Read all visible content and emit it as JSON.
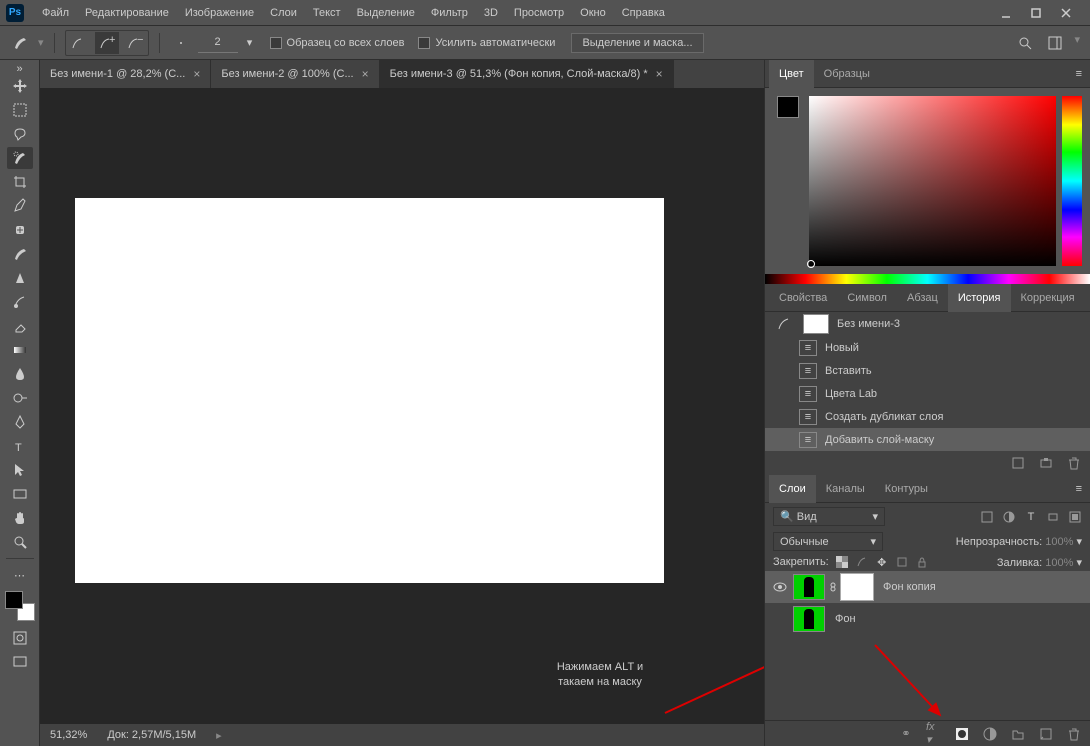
{
  "menubar": {
    "items": [
      "Файл",
      "Редактирование",
      "Изображение",
      "Слои",
      "Текст",
      "Выделение",
      "Фильтр",
      "3D",
      "Просмотр",
      "Окно",
      "Справка"
    ]
  },
  "options_bar": {
    "brush_size": "2",
    "sample_all": "Образец со всех слоев",
    "auto_enhance": "Усилить автоматически",
    "select_mask": "Выделение и маска..."
  },
  "doc_tabs": [
    {
      "label": "Без имени-1 @ 28,2% (С...",
      "active": false
    },
    {
      "label": "Без имени-2 @ 100% (С...",
      "active": false
    },
    {
      "label": "Без имени-3 @ 51,3% (Фон копия, Слой-маска/8) *",
      "active": true
    }
  ],
  "status": {
    "zoom": "51,32%",
    "doc": "Док: 2,57M/5,15M"
  },
  "color_panel": {
    "tabs": [
      "Цвет",
      "Образцы"
    ]
  },
  "props_panel": {
    "tabs": [
      "Свойства",
      "Символ",
      "Абзац",
      "История",
      "Коррекция"
    ],
    "active": 3
  },
  "history": {
    "doc_name": "Без имени-3",
    "items": [
      "Новый",
      "Вставить",
      "Цвета Lab",
      "Создать дубликат слоя",
      "Добавить слой-маску"
    ]
  },
  "layers_panel": {
    "tabs": [
      "Слои",
      "Каналы",
      "Контуры"
    ],
    "search": "Вид",
    "blend": "Обычные",
    "opacity_label": "Непрозрачность:",
    "opacity": "100%",
    "lock_label": "Закрепить:",
    "fill_label": "Заливка:",
    "fill": "100%",
    "layers": [
      {
        "name": "Фон копия",
        "has_mask": true,
        "active": true,
        "visible": true
      },
      {
        "name": "Фон",
        "has_mask": false,
        "active": false,
        "visible": false
      }
    ]
  },
  "annotation": {
    "line1": "Нажимаем ALT и",
    "line2": "такаем на маску"
  },
  "layers_footer_icons": [
    "link",
    "fx",
    "mask",
    "adjust",
    "group",
    "new",
    "trash"
  ]
}
